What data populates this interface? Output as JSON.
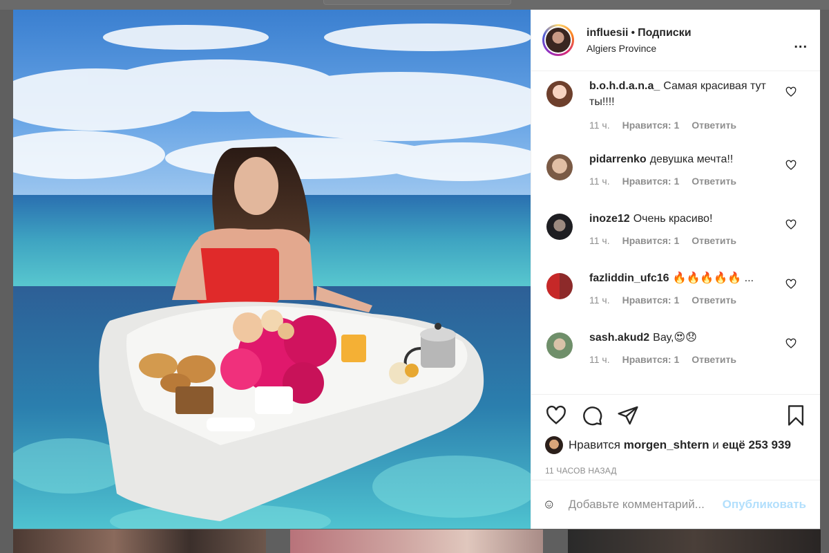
{
  "post": {
    "username": "influesii",
    "dot": "•",
    "follow_label": "Подписки",
    "location": "Algiers Province",
    "more": "..."
  },
  "comments": [
    {
      "user": "b.o.h.d.a.n.a_",
      "text": "Самая красивая тут ты!!!!",
      "time": "11 ч.",
      "likes": "Нравится: 1",
      "reply": "Ответить"
    },
    {
      "user": "pidarrenko",
      "text": "девушка мечта!!",
      "time": "11 ч.",
      "likes": "Нравится: 1",
      "reply": "Ответить"
    },
    {
      "user": "inoze12",
      "text": "Очень красиво!",
      "time": "11 ч.",
      "likes": "Нравится: 1",
      "reply": "Ответить"
    },
    {
      "user": "fazliddin_ufc16",
      "text": "🔥🔥🔥🔥🔥 ...",
      "time": "11 ч.",
      "likes": "Нравится: 1",
      "reply": "Ответить"
    },
    {
      "user": "sash.akud2",
      "text": "Вау,😍😞",
      "time": "11 ч.",
      "likes": "Нравится: 1",
      "reply": "Ответить"
    }
  ],
  "likes": {
    "prefix": "Нравится",
    "user": "morgen_shtern",
    "middle": "и",
    "count": "ещё 253 939"
  },
  "time_ago": "11 ЧАСОВ НАЗАД",
  "add_comment": {
    "placeholder": "Добавьте комментарий...",
    "publish": "Опубликовать"
  },
  "icons": {
    "like": "heart-icon",
    "comment": "comment-icon",
    "share": "share-icon",
    "save": "bookmark-icon",
    "emoji": "emoji-icon",
    "more": "more-icon"
  },
  "colors": {
    "publish_disabled": "#b2dffc",
    "meta_gray": "#8e8e8e",
    "text": "#262626"
  }
}
